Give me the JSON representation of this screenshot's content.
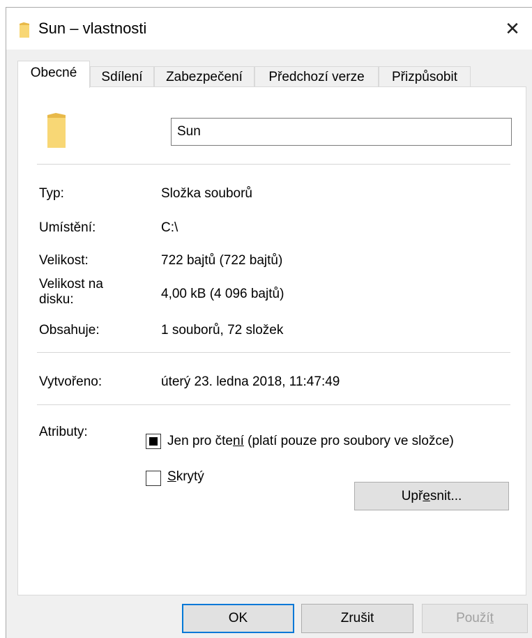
{
  "window": {
    "title": "Sun – vlastnosti",
    "close_label": "✕"
  },
  "tabs": [
    {
      "label": "Obecné"
    },
    {
      "label": "Sdílení"
    },
    {
      "label": "Zabezpečení"
    },
    {
      "label": "Předchozí verze"
    },
    {
      "label": "Přizpůsobit"
    }
  ],
  "general": {
    "name_value": "Sun",
    "type_label": "Typ:",
    "type_value": "Složka souborů",
    "location_label": "Umístění:",
    "location_value": "C:\\",
    "size_label": "Velikost:",
    "size_value": "722 bajtů (722 bajtů)",
    "size_on_disk_label_1": "Velikost na",
    "size_on_disk_label_2": "disku:",
    "size_on_disk_value": "4,00 kB (4 096 bajtů)",
    "contains_label": "Obsahuje:",
    "contains_value": "1 souborů, 72 složek",
    "created_label": "Vytvořeno:",
    "created_value": "úterý 23. ledna 2018, 11:47:49",
    "attributes_label": "Atributy:",
    "readonly_pre": "Jen pro čte",
    "readonly_accel": "ní",
    "readonly_post": " (platí pouze pro soubory ve složce)",
    "readonly_state": "indeterminate",
    "hidden_accel": "S",
    "hidden_post": "krytý",
    "hidden_state": "unchecked",
    "advanced_pre": "Upř",
    "advanced_accel": "e",
    "advanced_post": "snit..."
  },
  "footer": {
    "ok_label": "OK",
    "cancel_label": "Zrušit",
    "apply_pre": "Použí",
    "apply_accel": "t"
  },
  "colors": {
    "accent": "#0078d7",
    "folder": "#f8d775",
    "folder_shade": "#e8b949"
  }
}
